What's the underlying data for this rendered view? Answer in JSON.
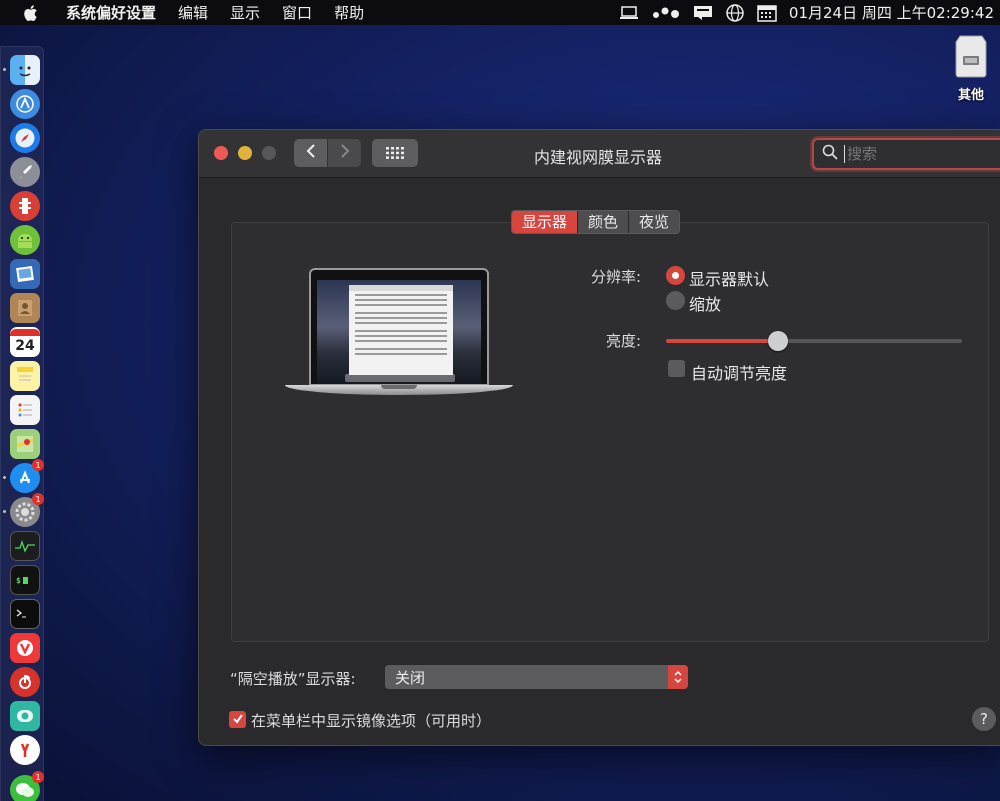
{
  "menubar": {
    "app_name": "系统偏好设置",
    "items": [
      "编辑",
      "显示",
      "窗口",
      "帮助"
    ],
    "clock": "01月24日 周四 上午02:29:42"
  },
  "desktop": {
    "drive_label": "其他"
  },
  "dock": {
    "badges": {
      "appstore": "1",
      "sysprefs": "1",
      "wechat": "1"
    },
    "calendar_day": "24"
  },
  "window": {
    "title": "内建视网膜显示器",
    "search_placeholder": "搜索",
    "tabs": [
      {
        "label": "显示器",
        "active": true
      },
      {
        "label": "颜色",
        "active": false
      },
      {
        "label": "夜览",
        "active": false
      }
    ],
    "resolution": {
      "label": "分辨率:",
      "options": [
        {
          "label": "显示器默认",
          "selected": true
        },
        {
          "label": "缩放",
          "selected": false
        }
      ]
    },
    "brightness": {
      "label": "亮度:",
      "value": 0.38,
      "auto_label": "自动调节亮度",
      "auto_checked": false
    },
    "airplay": {
      "label": "“隔空播放”显示器:",
      "value": "关闭"
    },
    "mirror": {
      "label": "在菜单栏中显示镜像选项（可用时）",
      "checked": true
    },
    "help_label": "?"
  },
  "colors": {
    "accent": "#d6463f",
    "window_bg": "#2a2a2c"
  }
}
